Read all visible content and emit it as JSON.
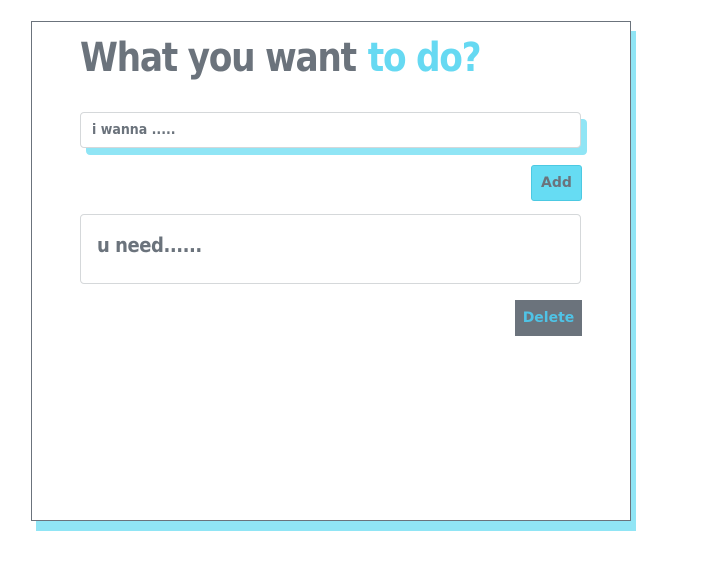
{
  "title": {
    "part1": "What you want",
    "part2": "to do?"
  },
  "input": {
    "placeholder": "i wanna .....",
    "value": ""
  },
  "buttons": {
    "add_label": "Add",
    "delete_label": "Delete"
  },
  "tasks": [
    {
      "text": "u need......"
    }
  ],
  "colors": {
    "accent": "#66d9f2",
    "accent_shadow": "#90e5f5",
    "text_gray": "#6b737c",
    "delete_text": "#4fc3e6"
  }
}
